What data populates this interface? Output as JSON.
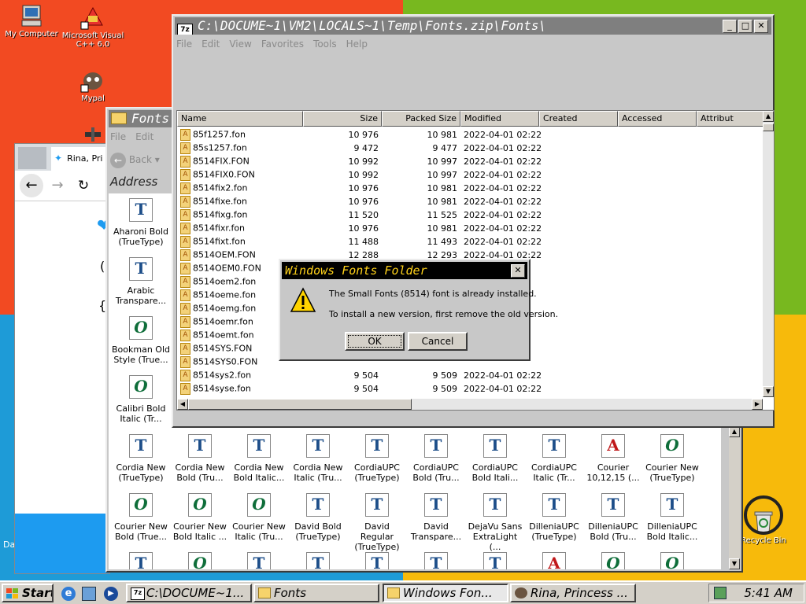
{
  "desktop": {
    "icons": [
      {
        "name": "my-computer",
        "label": "My Computer"
      },
      {
        "name": "microsoft-visual-cpp",
        "label": "Microsoft Visual C++ 6.0"
      },
      {
        "name": "mypal",
        "label": "Mypal"
      },
      {
        "name": "recycle-bin",
        "label": "Recycle Bin"
      }
    ],
    "edge_text": "Da"
  },
  "browser": {
    "tab_title": "Rina, Pri"
  },
  "fonts_window": {
    "title": "Fonts",
    "menu": [
      "File",
      "Edit"
    ],
    "back_label": "Back",
    "address_label": "Address",
    "left_column": [
      {
        "label": "Aharoni Bold (TrueType)",
        "glyph": "T"
      },
      {
        "label": "Arabic Transpare...",
        "glyph": "T"
      },
      {
        "label": "Bookman Old Style (True...",
        "glyph": "O"
      },
      {
        "label": "Calibri Bold Italic (Tr...",
        "glyph": "O"
      }
    ],
    "row1": [
      {
        "label": "Cordia New (TrueType)",
        "glyph": "T"
      },
      {
        "label": "Cordia New Bold (Tru...",
        "glyph": "T"
      },
      {
        "label": "Cordia New Bold Italic...",
        "glyph": "T"
      },
      {
        "label": "Cordia New Italic (Tru...",
        "glyph": "T"
      },
      {
        "label": "CordiaUPC (TrueType)",
        "glyph": "T"
      },
      {
        "label": "CordiaUPC Bold (Tru...",
        "glyph": "T"
      },
      {
        "label": "CordiaUPC Bold Itali...",
        "glyph": "T"
      },
      {
        "label": "CordiaUPC Italic (Tr...",
        "glyph": "T"
      },
      {
        "label": "Courier 10,12,15 (...",
        "glyph": "A"
      },
      {
        "label": "Courier New (TrueType)",
        "glyph": "O"
      }
    ],
    "row2": [
      {
        "label": "Courier New Bold (True...",
        "glyph": "O"
      },
      {
        "label": "Courier New Bold Italic ...",
        "glyph": "O"
      },
      {
        "label": "Courier New Italic (Tru...",
        "glyph": "O"
      },
      {
        "label": "David Bold (TrueType)",
        "glyph": "T"
      },
      {
        "label": "David Regular (TrueType)",
        "glyph": "T"
      },
      {
        "label": "David Transpare...",
        "glyph": "T"
      },
      {
        "label": "DejaVu Sans ExtraLight (...",
        "glyph": "T"
      },
      {
        "label": "DilleniaUPC (TrueType)",
        "glyph": "T"
      },
      {
        "label": "DilleniaUPC Bold (Tru...",
        "glyph": "T"
      },
      {
        "label": "DilleniaUPC Bold Italic...",
        "glyph": "T"
      }
    ],
    "row3_glyphs": [
      "T",
      "O",
      "T",
      "T",
      "T",
      "T",
      "T",
      "A",
      "O",
      "O"
    ]
  },
  "zip_window": {
    "title": "C:\\DOCUME~1\\VM2\\LOCALS~1\\Temp\\Fonts.zip\\Fonts\\",
    "menu": [
      "File",
      "Edit",
      "View",
      "Favorites",
      "Tools",
      "Help"
    ],
    "columns": [
      "Name",
      "Size",
      "Packed Size",
      "Modified",
      "Created",
      "Accessed",
      "Attribut"
    ],
    "rows": [
      {
        "name": "85f1257.fon",
        "size": "10 976",
        "packed": "10 981",
        "modified": "2022-04-01 02:22"
      },
      {
        "name": "85s1257.fon",
        "size": "9 472",
        "packed": "9 477",
        "modified": "2022-04-01 02:22"
      },
      {
        "name": "8514FIX.FON",
        "size": "10 992",
        "packed": "10 997",
        "modified": "2022-04-01 02:22"
      },
      {
        "name": "8514FIX0.FON",
        "size": "10 992",
        "packed": "10 997",
        "modified": "2022-04-01 02:22"
      },
      {
        "name": "8514fix2.fon",
        "size": "10 976",
        "packed": "10 981",
        "modified": "2022-04-01 02:22"
      },
      {
        "name": "8514fixe.fon",
        "size": "10 976",
        "packed": "10 981",
        "modified": "2022-04-01 02:22"
      },
      {
        "name": "8514fixg.fon",
        "size": "11 520",
        "packed": "11 525",
        "modified": "2022-04-01 02:22"
      },
      {
        "name": "8514fixr.fon",
        "size": "10 976",
        "packed": "10 981",
        "modified": "2022-04-01 02:22"
      },
      {
        "name": "8514fixt.fon",
        "size": "11 488",
        "packed": "11 493",
        "modified": "2022-04-01 02:22"
      },
      {
        "name": "8514OEM.FON",
        "size": "12 288",
        "packed": "12 293",
        "modified": "2022-04-01 02:22"
      },
      {
        "name": "8514OEM0.FON",
        "size": "",
        "packed": "",
        "modified": ""
      },
      {
        "name": "8514oem2.fon",
        "size": "",
        "packed": "",
        "modified": ""
      },
      {
        "name": "8514oeme.fon",
        "size": "",
        "packed": "",
        "modified": ""
      },
      {
        "name": "8514oemg.fon",
        "size": "",
        "packed": "",
        "modified": ""
      },
      {
        "name": "8514oemr.fon",
        "size": "",
        "packed": "",
        "modified": ""
      },
      {
        "name": "8514oemt.fon",
        "size": "",
        "packed": "",
        "modified": ""
      },
      {
        "name": "8514SYS.FON",
        "size": "",
        "packed": "",
        "modified": ""
      },
      {
        "name": "8514SYS0.FON",
        "size": "",
        "packed": "",
        "modified": ""
      },
      {
        "name": "8514sys2.fon",
        "size": "9 504",
        "packed": "9 509",
        "modified": "2022-04-01 02:22"
      },
      {
        "name": "8514syse.fon",
        "size": "9 504",
        "packed": "9 509",
        "modified": "2022-04-01 02:22"
      }
    ]
  },
  "dialog": {
    "title": "Windows Fonts Folder",
    "message1": "The Small Fonts (8514) font is already installed.",
    "message2": "To install a new version, first remove the old version.",
    "ok": "OK",
    "cancel": "Cancel"
  },
  "taskbar": {
    "start": "Start",
    "tasks": [
      {
        "label": "C:\\DOCUME~1..."
      },
      {
        "label": "Fonts"
      },
      {
        "label": "Windows Fon..."
      },
      {
        "label": "Rina, Princess ..."
      }
    ],
    "clock": "5:41 AM"
  }
}
